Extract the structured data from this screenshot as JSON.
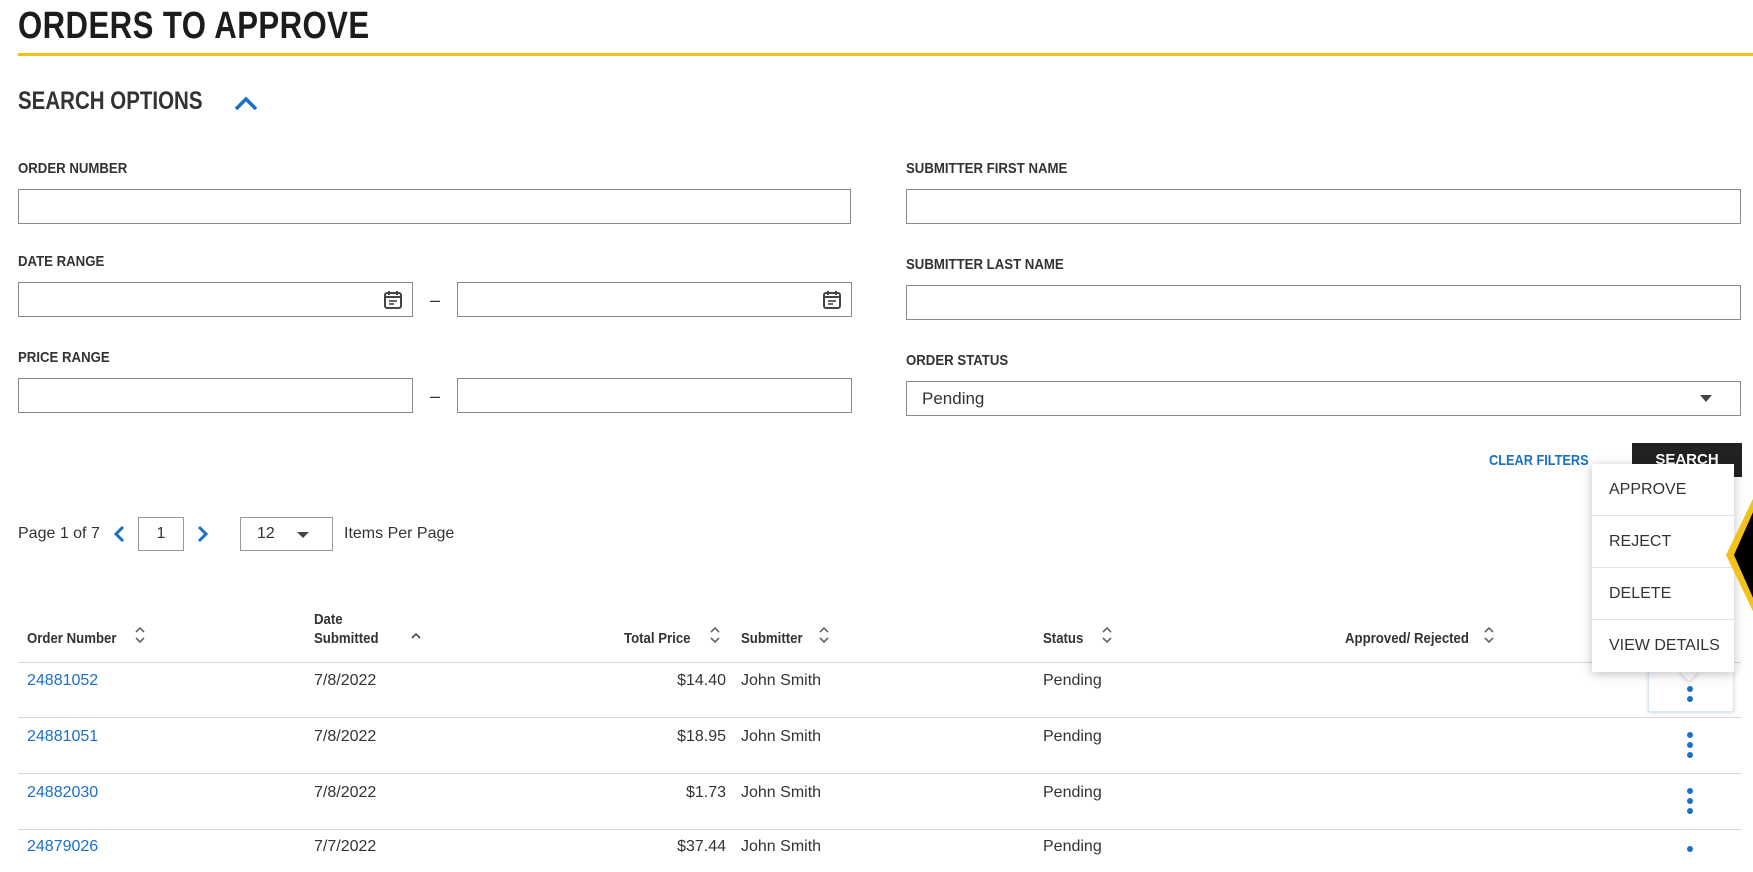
{
  "page": {
    "title": "ORDERS TO APPROVE"
  },
  "search_options": {
    "heading": "SEARCH OPTIONS",
    "order_number": {
      "label": "ORDER NUMBER",
      "value": ""
    },
    "date_range": {
      "label": "DATE RANGE",
      "from": "",
      "to": "",
      "separator": "–"
    },
    "price_range": {
      "label": "PRICE RANGE",
      "min": "",
      "max": "",
      "separator": "–"
    },
    "submitter_first_name": {
      "label": "SUBMITTER FIRST NAME",
      "value": ""
    },
    "submitter_last_name": {
      "label": "SUBMITTER LAST NAME",
      "value": ""
    },
    "order_status": {
      "label": "ORDER STATUS",
      "selected": "Pending"
    },
    "clear_filters": "CLEAR FILTERS",
    "search_button": "SEARCH"
  },
  "pagination": {
    "page_prefix": "Page 1 of 7",
    "current_page": "1",
    "per_page": "12",
    "per_page_label": "Items Per Page"
  },
  "table": {
    "columns": {
      "order_number": "Order Number",
      "date_submitted_line1": "Date",
      "date_submitted_line2": "Submitted",
      "total_price": "Total Price",
      "submitter": "Submitter",
      "status": "Status",
      "approved_rejected": "Approved/ Rejected"
    },
    "rows": [
      {
        "order_number": "24881052",
        "date": "7/8/2022",
        "price": "$14.40",
        "submitter": "John Smith",
        "status": "Pending"
      },
      {
        "order_number": "24881051",
        "date": "7/8/2022",
        "price": "$18.95",
        "submitter": "John Smith",
        "status": "Pending"
      },
      {
        "order_number": "24882030",
        "date": "7/8/2022",
        "price": "$1.73",
        "submitter": "John Smith",
        "status": "Pending"
      },
      {
        "order_number": "24879026",
        "date": "7/7/2022",
        "price": "$37.44",
        "submitter": "John Smith",
        "status": "Pending"
      }
    ]
  },
  "action_menu": {
    "items": [
      "APPROVE",
      "REJECT",
      "DELETE",
      "VIEW DETAILS"
    ]
  },
  "icons": {
    "chevron_up": "chevron-up-icon",
    "calendar": "calendar-icon",
    "caret_down": "caret-down-icon",
    "chevron_left": "chevron-left-icon",
    "chevron_right": "chevron-right-icon",
    "sort": "sort-icon",
    "more_vertical": "more-vertical-icon"
  },
  "colors": {
    "accent_yellow": "#f2c21b",
    "link_blue": "#1a6fc9",
    "button_dark": "#222222"
  }
}
